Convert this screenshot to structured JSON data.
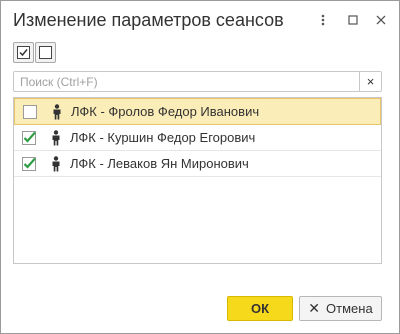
{
  "window": {
    "title": "Изменение параметров сеансов",
    "menu_icon": "more-vertical-icon",
    "maximize_icon": "maximize-icon",
    "close_icon": "close-icon"
  },
  "toolbar": {
    "check_all_icon": "check-all-icon",
    "uncheck_all_icon": "uncheck-all-icon"
  },
  "search": {
    "placeholder": "Поиск (Ctrl+F)",
    "value": "",
    "clear_label": "×"
  },
  "list": {
    "items": [
      {
        "checked": false,
        "selected": true,
        "icon": "user-icon",
        "label": "ЛФК - Фролов Федор Иванович"
      },
      {
        "checked": true,
        "selected": false,
        "icon": "user-icon",
        "label": "ЛФК - Куршин Федор Егорович"
      },
      {
        "checked": true,
        "selected": false,
        "icon": "user-icon",
        "label": "ЛФК - Леваков Ян Миронович"
      }
    ]
  },
  "buttons": {
    "ok_label": "ОК",
    "cancel_label": "Отмена",
    "cancel_icon_glyph": "✕"
  },
  "colors": {
    "accent": "#f7d91c",
    "selected_row": "#fbedb7",
    "check": "#2f9e44"
  }
}
